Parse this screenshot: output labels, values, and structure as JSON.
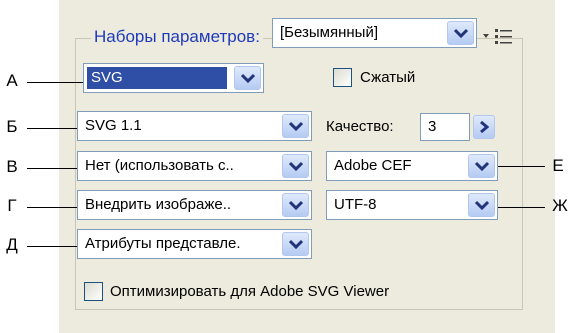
{
  "group": {
    "label": "Наборы параметров:",
    "preset_value": "[Безымянный]",
    "menu_icon": "panel-menu-icon"
  },
  "left": {
    "format_value": "SVG",
    "version_value": "SVG 1.1",
    "fonts_value": "Нет (использовать с..",
    "images_value": "Внедрить изображе..",
    "css_value": "Атрибуты представле."
  },
  "right": {
    "compressed_label": "Сжатый",
    "quality_label": "Качество:",
    "quality_value": "3",
    "decimal_value": "Adobe CEF",
    "encoding_value": "UTF-8"
  },
  "optimize_label": "Оптимизировать для Adobe SVG Viewer",
  "callouts": {
    "a": "А",
    "b": "Б",
    "v": "В",
    "g": "Г",
    "d": "Д",
    "e": "Е",
    "zh": "Ж"
  },
  "colors": {
    "panel_bg": "#ecebdd",
    "accent_label": "#1f3bbb",
    "selection": "#2f4fa6",
    "button_gradient_top": "#dfe9fb",
    "button_gradient_bottom": "#b5cbf3"
  }
}
